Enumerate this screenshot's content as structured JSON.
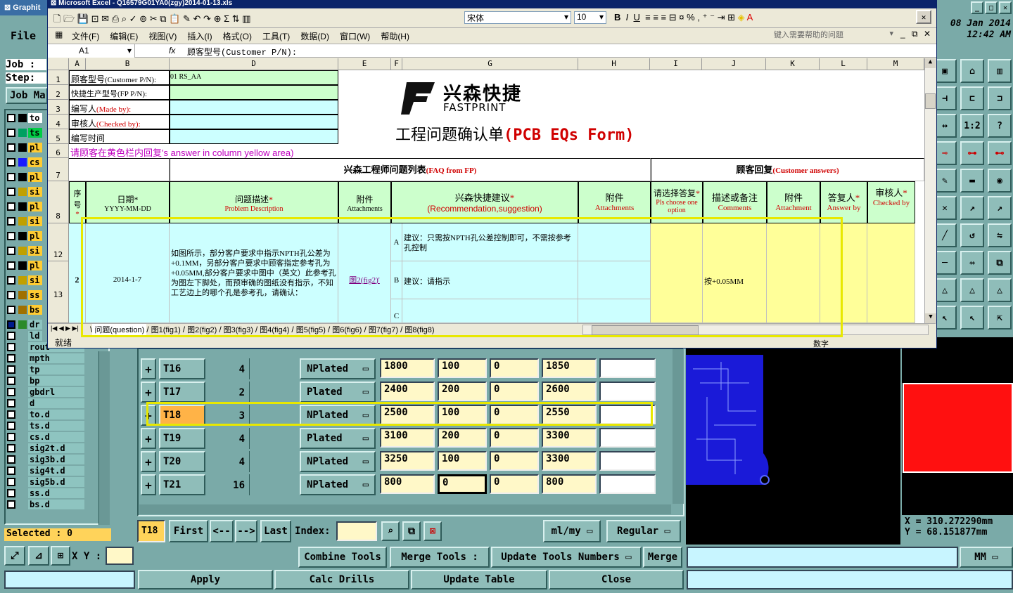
{
  "cam": {
    "app_title": "Graphit",
    "file_menu": "File",
    "job_label": "Job :",
    "step_label": "Step:",
    "job_manager_btn": "Job Ma",
    "date": "08 Jan 2014",
    "time": "12:42 AM",
    "layers_top": [
      "to",
      "ts",
      "pl",
      "cs",
      "pl",
      "si",
      "pl",
      "si",
      "pl",
      "si",
      "pl",
      "si",
      "ss",
      "bs",
      "dr",
      "ld",
      "rout",
      "mpth",
      "tp",
      "bp",
      "gbdrl",
      "d",
      "to.d",
      "ts.d",
      "cs.d",
      "sig2t.d",
      "sig3b.d",
      "sig4t.d",
      "sig5b.d",
      "ss.d",
      "bs.d"
    ],
    "selected_label": "Selected : 0",
    "xy_label": "X Y :",
    "coord_x": "X  =  310.272290mm",
    "coord_y": "Y  =  68.151877mm",
    "units": "MM",
    "tools": [
      {
        "num": "T16",
        "count": "4",
        "type": "NPlated",
        "v1": "1800",
        "v2": "100",
        "v3": "0",
        "v4": "1850"
      },
      {
        "num": "T17",
        "count": "2",
        "type": "Plated",
        "v1": "2400",
        "v2": "200",
        "v3": "0",
        "v4": "2600"
      },
      {
        "num": "T18",
        "count": "3",
        "type": "NPlated",
        "v1": "2500",
        "v2": "100",
        "v3": "0",
        "v4": "2550"
      },
      {
        "num": "T19",
        "count": "4",
        "type": "Plated",
        "v1": "3100",
        "v2": "200",
        "v3": "0",
        "v4": "3300"
      },
      {
        "num": "T20",
        "count": "4",
        "type": "NPlated",
        "v1": "3250",
        "v2": "100",
        "v3": "0",
        "v4": "3300"
      },
      {
        "num": "T21",
        "count": "16",
        "type": "NPlated",
        "v1": "800",
        "v2": "0",
        "v3": "0",
        "v4": "800"
      }
    ],
    "nav": {
      "current": "T18",
      "first": "First",
      "prev": "<--",
      "next": "-->",
      "last": "Last",
      "index": "Index:",
      "units": "ml/my",
      "mode": "Regular"
    },
    "actions": {
      "combine": "Combine Tools",
      "merge_tools": "Merge Tools :",
      "update_numbers": "Update Tools Numbers",
      "merge": "Merge",
      "apply": "Apply",
      "calc": "Calc Drills",
      "update_table": "Update Table",
      "close": "Close"
    },
    "status_num": "数字"
  },
  "excel": {
    "title": "Microsoft Excel - Q16579G01YA0(zgy)2014-01-13.xls",
    "font_name": "宋体",
    "font_size": "10",
    "menus": [
      "文件(F)",
      "编辑(E)",
      "视图(V)",
      "插入(I)",
      "格式(O)",
      "工具(T)",
      "数据(D)",
      "窗口(W)",
      "帮助(H)"
    ],
    "help_placeholder": "键入需要帮助的问题",
    "cell_ref": "A1",
    "formula": "顾客型号(Customer P/N):",
    "col_headers": [
      "A",
      "B",
      "D",
      "E",
      "F",
      "G",
      "H",
      "I",
      "J",
      "K",
      "L",
      "M"
    ],
    "row_headers": [
      "1",
      "2",
      "3",
      "4",
      "5",
      "6",
      "7",
      "8",
      "12",
      "13"
    ],
    "labels": {
      "r1_prefix": "顾客型号",
      "r1": "(Customer P/N):",
      "r1_val": "01 RS_AA",
      "r2": "快捷生产型号(FP P/N):",
      "r3_prefix": "编写人",
      "r3": "(Made by):",
      "r4_prefix": "审核人",
      "r4": "(Checked by):",
      "r5": "编写时间",
      "r6_a": "请顾客在黄色栏内回复",
      "r6_b": "'s answer in column yellow area)"
    },
    "logo_cn": "兴森快捷",
    "logo_en": "FASTPRINT",
    "form_title_cn": "工程问题确认单",
    "form_title_en": "(PCB EQs Form)",
    "faq_cn": "兴森工程师问题列表",
    "faq_en": "(FAQ from FP)",
    "cust_cn": "顾客回复",
    "cust_en": "(Customer answers)",
    "h_seq": "序号",
    "h_date_cn": "日期*",
    "h_date_fmt": "YYYY-MM-DD",
    "h_desc_cn": "问题描述",
    "h_desc_en": "Problem Description",
    "h_att_cn": "附件",
    "h_att_en": "Attachments",
    "h_rec_cn": "兴森快捷建议",
    "h_rec_en": "(Recommendation,suggestion)",
    "h_att2_cn": "附件",
    "h_att2_en": "Attachments",
    "h_choose_cn": "请选择答复",
    "h_choose_en": "Pls choose one option",
    "h_desc2_cn": "描述或备注",
    "h_desc2_en": "Comments",
    "h_att3_cn": "附件",
    "h_att3_en": "Attachment",
    "h_ans_cn": "答复人",
    "h_ans_en": "Answer by",
    "h_chk_cn": "审核人",
    "h_chk_en": "Checked by",
    "row_seq": "2",
    "row_date": "2014-1-7",
    "row_desc": "如图所示，部分客户要求中指示NPTH孔公差为+0.1MM，另部分客户要求中顾客指定参考孔为+0.05MM,部分客户要求中图中（英文）此参考孔为图左下脚处，而预审确的图纸没有指示，不知工艺边上的哪个孔是参考孔，请确认：",
    "row_att": "图2(fig2)'",
    "opt_a": "A",
    "opt_a_text": "建议：只需按NPTH孔公差控制即可，不需按参考孔控制",
    "opt_b": "B",
    "opt_b_text": "建议：请指示",
    "opt_c": "C",
    "answer_comment": "按+0.05MM",
    "sheets": [
      "问题(question)",
      "图1(fig1)",
      "图2(fig2)",
      "图3(fig3)",
      "图4(fig4)",
      "图5(fig5)",
      "图6(fig6)",
      "图7(fig7)",
      "图8(fig8)"
    ],
    "status": "就绪",
    "status_num": "数字"
  }
}
